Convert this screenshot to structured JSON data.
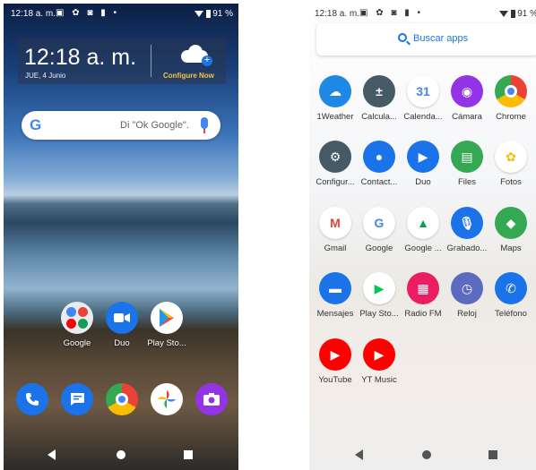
{
  "home": {
    "status_time": "12:18 a. m.",
    "status_icons": "▣ ✿ ◙ ▮ •",
    "battery": "91 %",
    "clock_time": "12:18 a. m.",
    "clock_date": "JUE, 4 Junio",
    "configure_label": "Configure Now",
    "search_hint": "Di \"Ok Google\".",
    "apps": [
      {
        "label": "Google"
      },
      {
        "label": "Duo"
      },
      {
        "label": "Play Sto..."
      }
    ],
    "dock": [
      {
        "icon": "phone-icon",
        "color": "#1a73e8"
      },
      {
        "icon": "messages-icon",
        "color": "#1a73e8"
      },
      {
        "icon": "chrome-icon",
        "color": "#ea4335"
      },
      {
        "icon": "photos-icon",
        "color": "#fbbc04"
      },
      {
        "icon": "camera-icon",
        "color": "#9334e6"
      }
    ]
  },
  "drawer": {
    "status_time": "12:18 a. m.",
    "status_icons": "▣ ✿ ◙ ▮ •",
    "battery": "91 %",
    "search_label": "Buscar apps",
    "apps": [
      {
        "label": "1Weather",
        "icon": "weather-icon",
        "color": "#1e88e5"
      },
      {
        "label": "Calcula...",
        "icon": "calculator-icon",
        "color": "#455a64"
      },
      {
        "label": "Calenda...",
        "icon": "calendar-icon",
        "color": "#4285f4"
      },
      {
        "label": "Cámara",
        "icon": "camera-icon",
        "color": "#9334e6"
      },
      {
        "label": "Chrome",
        "icon": "chrome-icon",
        "color": "#ea4335"
      },
      {
        "label": "Configur...",
        "icon": "settings-icon",
        "color": "#455a64"
      },
      {
        "label": "Contact...",
        "icon": "contacts-icon",
        "color": "#1a73e8"
      },
      {
        "label": "Duo",
        "icon": "duo-icon",
        "color": "#1a73e8"
      },
      {
        "label": "Files",
        "icon": "files-icon",
        "color": "#34a853"
      },
      {
        "label": "Fotos",
        "icon": "photos-icon",
        "color": "#fbbc04"
      },
      {
        "label": "Gmail",
        "icon": "gmail-icon",
        "color": "#ea4335"
      },
      {
        "label": "Google",
        "icon": "google-icon",
        "color": "#4285f4"
      },
      {
        "label": "Google ...",
        "icon": "drive-icon",
        "color": "#0f9d58"
      },
      {
        "label": "Grabado...",
        "icon": "recorder-icon",
        "color": "#1a73e8"
      },
      {
        "label": "Maps",
        "icon": "maps-icon",
        "color": "#34a853"
      },
      {
        "label": "Mensajes",
        "icon": "messages-icon",
        "color": "#1a73e8"
      },
      {
        "label": "Play Sto...",
        "icon": "play-store-icon",
        "color": "#00c853"
      },
      {
        "label": "Radio FM",
        "icon": "radio-icon",
        "color": "#e91e63"
      },
      {
        "label": "Reloj",
        "icon": "clock-icon",
        "color": "#5c6bc0"
      },
      {
        "label": "Teléfono",
        "icon": "phone-icon",
        "color": "#1a73e8"
      },
      {
        "label": "YouTube",
        "icon": "youtube-icon",
        "color": "#ff0000"
      },
      {
        "label": "YT Music",
        "icon": "yt-music-icon",
        "color": "#ff0000"
      }
    ]
  }
}
